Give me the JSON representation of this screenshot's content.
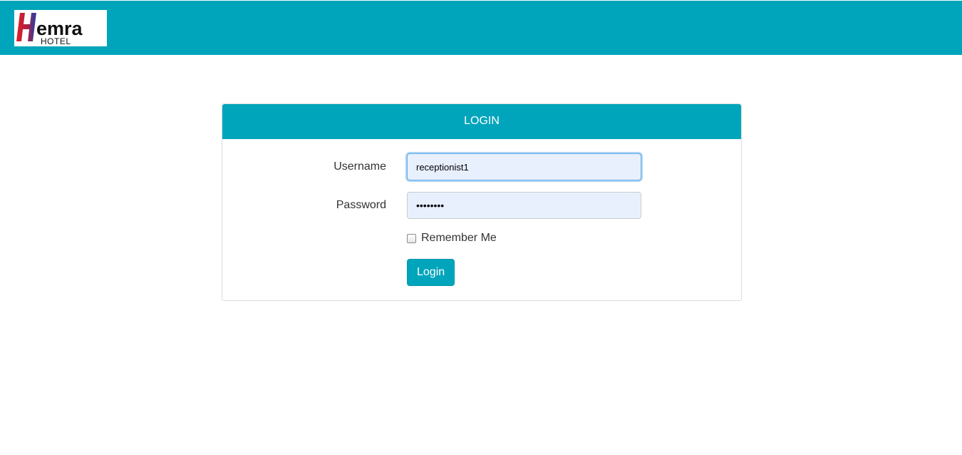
{
  "header": {
    "logo_text": "Hemra",
    "logo_subtext": "HOTEL",
    "bar_color": "#00a5bb"
  },
  "login_panel": {
    "title": "LOGIN",
    "username_label": "Username",
    "username_value": "receptionist1",
    "password_label": "Password",
    "password_value": "••••••••",
    "remember_label": "Remember Me",
    "remember_checked": false,
    "submit_label": "Login"
  },
  "colors": {
    "accent": "#00a5bb",
    "input_fill": "#e8f0fe"
  }
}
